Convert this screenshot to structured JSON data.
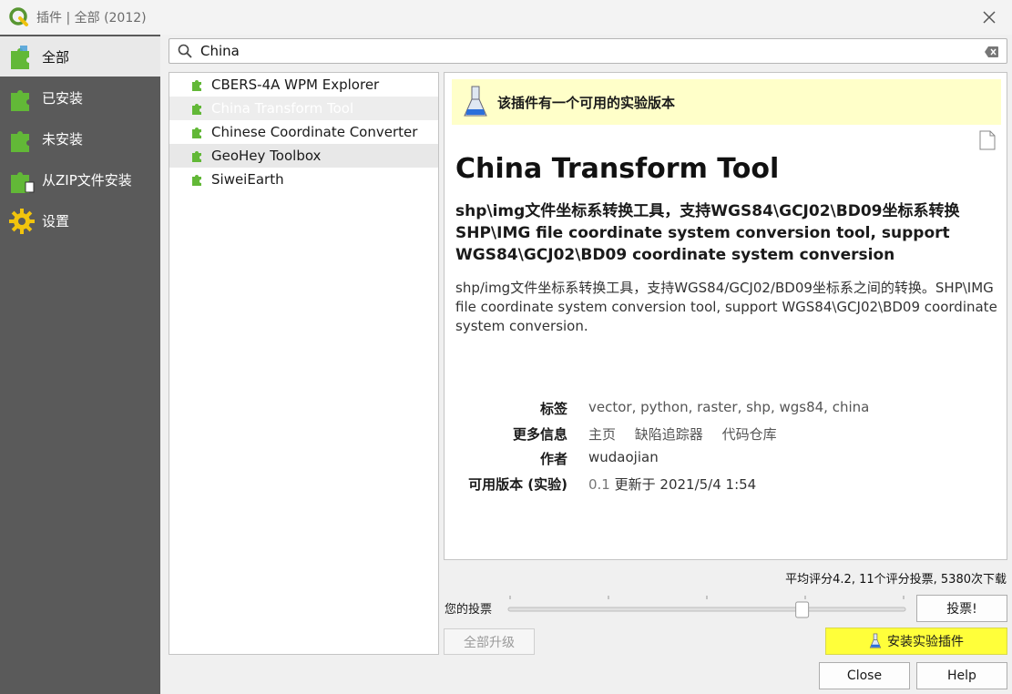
{
  "window": {
    "title": "插件 | 全部 (2012)"
  },
  "sidebar": {
    "items": [
      {
        "label": "全部",
        "icon": "puzzle-icon"
      },
      {
        "label": "已安装",
        "icon": "puzzle-icon"
      },
      {
        "label": "未安装",
        "icon": "puzzle-icon"
      },
      {
        "label": "从ZIP文件安装",
        "icon": "puzzle-zip-icon"
      },
      {
        "label": "设置",
        "icon": "gear-icon"
      }
    ]
  },
  "search": {
    "value": "China"
  },
  "plugins": [
    "CBERS-4A WPM Explorer",
    "China Transform Tool",
    "Chinese Coordinate Converter",
    "GeoHey Toolbox",
    "SiweiEarth"
  ],
  "details": {
    "banner": "该插件有一个可用的实验版本",
    "name": "China Transform Tool",
    "summary": "shp\\img文件坐标系转换工具，支持WGS84\\GCJ02\\BD09坐标系转换 SHP\\IMG file coordinate system conversion tool, support WGS84\\GCJ02\\BD09 coordinate system conversion",
    "description": "shp/img文件坐标系转换工具，支持WGS84/GCJ02/BD09坐标系之间的转换。SHP\\IMG file coordinate system conversion tool, support WGS84\\GCJ02\\BD09 coordinate system conversion.",
    "tags_label": "标签",
    "tags": "vector, python, raster, shp, wgs84, china",
    "more_info_label": "更多信息",
    "links": [
      "主页",
      "缺陷追踪器",
      "代码仓库"
    ],
    "author_label": "作者",
    "author": "wudaojian",
    "version_label": "可用版本 (实验)",
    "version": "0.1",
    "updated": "更新于 2021/5/4 1:54"
  },
  "rating": {
    "summary": "平均评分4.2, 11个评分投票, 5380次下载",
    "vote_label": "您的投票",
    "vote_button": "投票!",
    "slider_fraction": 0.74
  },
  "buttons": {
    "upgrade_all": "全部升级",
    "install_experimental": "安装实验插件",
    "close": "Close",
    "help": "Help"
  },
  "colors": {
    "sidebar_bg": "#5a5a5a",
    "banner_bg": "#ffffc9",
    "install_button": "#ffff3a",
    "puzzle_green": "#62b837"
  }
}
